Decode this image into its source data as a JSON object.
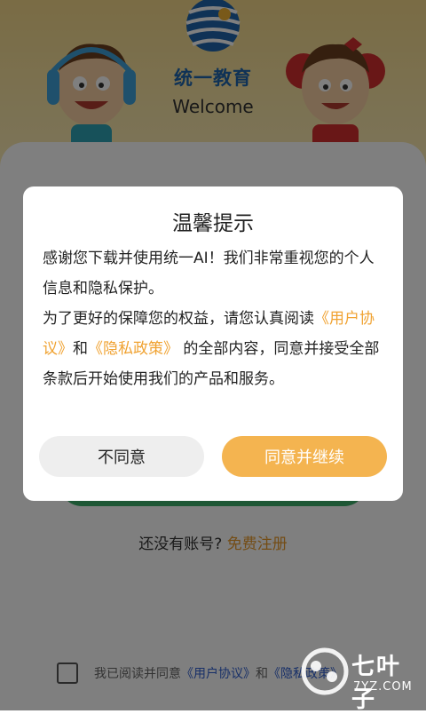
{
  "header": {
    "brand": "统一教育",
    "welcome": "Welcome"
  },
  "login": {
    "no_account": "还没有账号?",
    "register": "免费注册",
    "agree_prefix": "我已阅读并同意",
    "agree_user_agreement": "《用户协议》",
    "agree_and": "和",
    "agree_privacy": "《隐私政策》"
  },
  "dialog": {
    "title": "温馨提示",
    "line1": "感谢您下载并使用统一AI！我们非常重视您的个人信息和隐私保护。",
    "line2_prefix": "为了更好的保障您的权益，请您认真阅读",
    "user_agreement": "《用户协议》",
    "and": "和",
    "privacy_policy": "《隐私政策》",
    "line2_suffix": " 的全部内容，同意并接受全部条款后开始使用我们的产品和服务。",
    "disagree_label": "不同意",
    "agree_label": "同意并继续"
  },
  "watermark": {
    "name": "七叶子",
    "site": "7YZ.COM"
  },
  "colors": {
    "accent": "#f4b450",
    "link": "#f0a231",
    "brand": "#1f64ad"
  },
  "icons": [
    "globe-logo-icon",
    "mascot-boy",
    "mascot-girl",
    "checkbox-icon",
    "leaf-watermark-icon"
  ]
}
